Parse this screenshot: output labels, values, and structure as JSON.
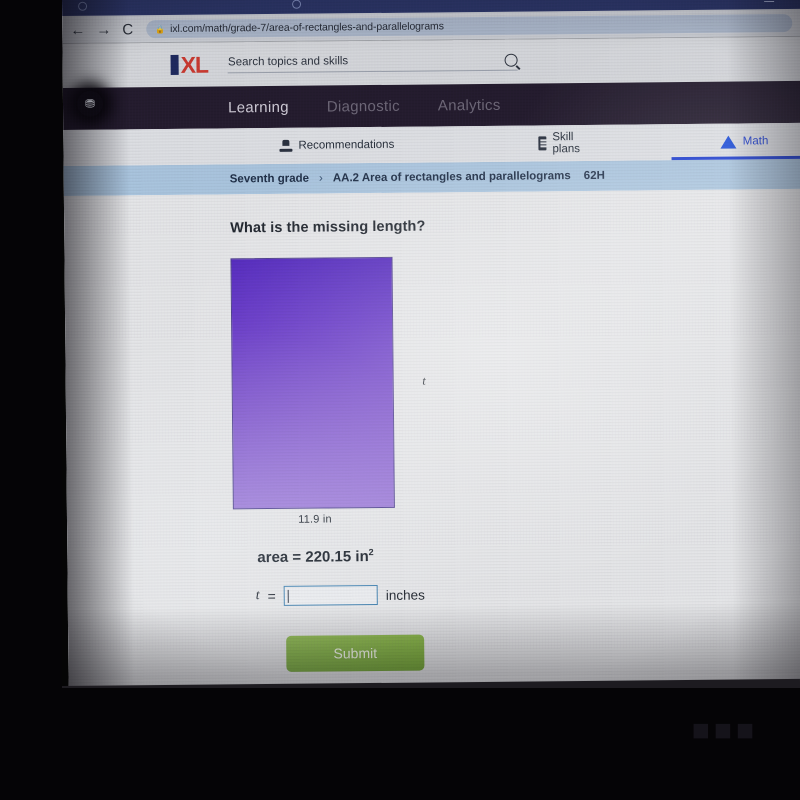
{
  "browser": {
    "tabs": [
      {
        "title": ""
      },
      {
        "title": ""
      }
    ],
    "nav": {
      "back": "←",
      "forward": "→",
      "reload": "C",
      "minimize": "—"
    },
    "omnibox": {
      "lock_icon": "lock-icon",
      "url": "ixl.com/math/grade-7/area-of-rectangles-and-parallelograms"
    }
  },
  "site_header": {
    "logo_i": "I",
    "logo_xl": "XL",
    "search_placeholder": "Search topics and skills",
    "search_icon": "search-icon",
    "avatar_icon": "user-avatar-icon"
  },
  "dark_nav": {
    "items": [
      {
        "label": "Learning",
        "active": true
      },
      {
        "label": "Diagnostic",
        "active": false
      },
      {
        "label": "Analytics",
        "active": false
      }
    ]
  },
  "tabs": {
    "items": [
      {
        "label": "Recommendations",
        "icon": "recommendations-icon",
        "active": false
      },
      {
        "label": "Skill plans",
        "icon": "skill-plans-icon",
        "active": false
      },
      {
        "label": "Math",
        "icon": "math-pyramid-icon",
        "active": true
      }
    ]
  },
  "breadcrumb": {
    "grade": "Seventh grade",
    "separator": "›",
    "skill": "AA.2 Area of rectangles and parallelograms",
    "code": "62H"
  },
  "question": {
    "prompt": "What is the missing length?",
    "figure": {
      "shape": "rectangle",
      "side_label_right": "t",
      "side_label_bottom": "11.9 in"
    },
    "area_label": "area = 220.15 in",
    "area_exponent": "2",
    "answer": {
      "variable": "t",
      "equals": "=",
      "value": "",
      "units": "inches"
    },
    "submit_label": "Submit"
  },
  "colors": {
    "accent_blue": "#1f3fcf",
    "logo_red": "#c8392f",
    "logo_navy": "#1f2a5e",
    "rect_top": "#5227bd",
    "rect_bottom": "#9c7ad8",
    "submit_green": "#77a83c",
    "breadcrumb_band": "#a9c4dd",
    "dark_band": "#241c2e"
  },
  "overlay": {
    "watermark": "■■■"
  }
}
